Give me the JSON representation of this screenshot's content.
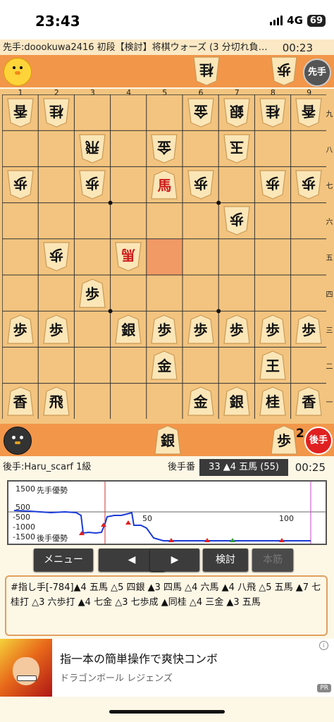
{
  "status": {
    "time": "23:43",
    "network": "4G",
    "battery": "69"
  },
  "header": {
    "sente_info": "先手:doookuwa2416 初段【検討】将棋ウォーズ (3 分切れ負…",
    "sente_clock": "00:23"
  },
  "sente_hand": {
    "badge": "先手",
    "pieces": [
      {
        "char": "桂",
        "gote": true
      },
      {
        "char": "歩",
        "gote": true
      }
    ]
  },
  "board": {
    "file_labels": [
      "1",
      "2",
      "3",
      "4",
      "5",
      "6",
      "7",
      "8",
      "9"
    ],
    "rank_labels": [
      "九",
      "八",
      "七",
      "六",
      "五",
      "四",
      "三",
      "二",
      "一"
    ],
    "pieces": [
      {
        "col": 0,
        "row": 0,
        "char": "香",
        "gote": true
      },
      {
        "col": 1,
        "row": 0,
        "char": "桂",
        "gote": true
      },
      {
        "col": 5,
        "row": 0,
        "char": "金",
        "gote": true
      },
      {
        "col": 6,
        "row": 0,
        "char": "銀",
        "gote": true
      },
      {
        "col": 7,
        "row": 0,
        "char": "桂",
        "gote": true
      },
      {
        "col": 8,
        "row": 0,
        "char": "香",
        "gote": true
      },
      {
        "col": 2,
        "row": 1,
        "char": "飛",
        "gote": true
      },
      {
        "col": 4,
        "row": 1,
        "char": "金",
        "gote": true
      },
      {
        "col": 6,
        "row": 1,
        "char": "玉",
        "gote": true
      },
      {
        "col": 0,
        "row": 2,
        "char": "歩",
        "gote": true
      },
      {
        "col": 2,
        "row": 2,
        "char": "歩",
        "gote": true
      },
      {
        "col": 4,
        "row": 2,
        "char": "馬",
        "gote": false,
        "promoted": true
      },
      {
        "col": 5,
        "row": 2,
        "char": "歩",
        "gote": true
      },
      {
        "col": 7,
        "row": 2,
        "char": "歩",
        "gote": true
      },
      {
        "col": 8,
        "row": 2,
        "char": "歩",
        "gote": true
      },
      {
        "col": 6,
        "row": 3,
        "char": "歩",
        "gote": true
      },
      {
        "col": 1,
        "row": 4,
        "char": "歩",
        "gote": true
      },
      {
        "col": 3,
        "row": 4,
        "char": "馬",
        "gote": true,
        "promoted": true
      },
      {
        "col": 2,
        "row": 5,
        "char": "歩",
        "gote": false
      },
      {
        "col": 0,
        "row": 6,
        "char": "歩",
        "gote": false
      },
      {
        "col": 1,
        "row": 6,
        "char": "歩",
        "gote": false
      },
      {
        "col": 3,
        "row": 6,
        "char": "銀",
        "gote": false
      },
      {
        "col": 4,
        "row": 6,
        "char": "歩",
        "gote": false
      },
      {
        "col": 5,
        "row": 6,
        "char": "歩",
        "gote": false
      },
      {
        "col": 6,
        "row": 6,
        "char": "歩",
        "gote": false
      },
      {
        "col": 7,
        "row": 6,
        "char": "歩",
        "gote": false
      },
      {
        "col": 8,
        "row": 6,
        "char": "歩",
        "gote": false
      },
      {
        "col": 4,
        "row": 7,
        "char": "金",
        "gote": false
      },
      {
        "col": 7,
        "row": 7,
        "char": "王",
        "gote": false
      },
      {
        "col": 0,
        "row": 8,
        "char": "香",
        "gote": false
      },
      {
        "col": 1,
        "row": 8,
        "char": "飛",
        "gote": false
      },
      {
        "col": 5,
        "row": 8,
        "char": "金",
        "gote": false
      },
      {
        "col": 6,
        "row": 8,
        "char": "銀",
        "gote": false
      },
      {
        "col": 7,
        "row": 8,
        "char": "桂",
        "gote": false
      },
      {
        "col": 8,
        "row": 8,
        "char": "香",
        "gote": false
      }
    ]
  },
  "gote_hand": {
    "badge": "後手",
    "pieces": [
      {
        "char": "銀",
        "gote": false
      },
      {
        "char": "歩",
        "gote": false,
        "count": "2"
      }
    ]
  },
  "footer": {
    "gote_info": "後手:Haru_scarf 1級",
    "turn_label": "後手番",
    "move_display": "33 ▲4 五馬 (55)",
    "gote_clock": "00:25"
  },
  "graph": {
    "y_labels": [
      "1500",
      "500",
      "-500",
      "-1000",
      "-1500"
    ],
    "sente_adv": "先手優勢",
    "gote_adv": "後手優勢",
    "x_labels": [
      "50",
      "100"
    ]
  },
  "buttons": {
    "menu": "メニュー",
    "prev": "◀",
    "next": "▶",
    "analyze": "検討",
    "main_line": "本筋"
  },
  "kifu_text": "#指し手[-784]▲4 五馬 △5 四銀 ▲3 四馬 △4 六馬 ▲4 八飛 △5 五馬 ▲7 七桂打 △3 六歩打 ▲4 七金 △3 七歩成 ▲同桂 △4 三金 ▲3 五馬",
  "ad": {
    "title": "指一本の簡単操作で爽快コンボ",
    "subtitle": "ドラゴンボール レジェンズ",
    "pr": "PR",
    "info": "i"
  }
}
